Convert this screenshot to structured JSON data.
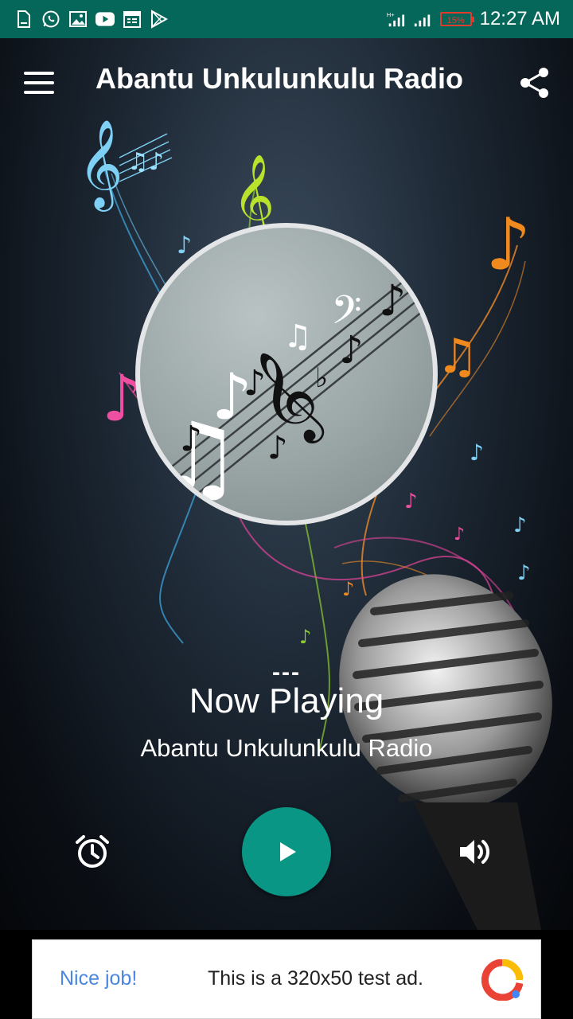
{
  "status_bar": {
    "time": "12:27 AM",
    "battery": "15%",
    "left_icons": [
      "file-icon",
      "whatsapp-icon",
      "image-icon",
      "youtube-icon",
      "calendar-icon",
      "play-store-icon"
    ],
    "right_icons": [
      "signal-ht-icon",
      "signal-icon",
      "battery-icon"
    ]
  },
  "app_bar": {
    "title": "Abantu Unkulunkulu Radio",
    "menu_icon": "hamburger-menu-icon",
    "share_icon": "share-icon"
  },
  "player": {
    "track_placeholder": "---",
    "now_playing_label": "Now Playing",
    "station_name": "Abantu Unkulunkulu Radio",
    "controls": {
      "alarm_icon": "alarm-clock-icon",
      "play_icon": "play-icon",
      "volume_icon": "volume-icon"
    }
  },
  "ad": {
    "badge": "Nice job!",
    "text": "This is a 320x50 test ad."
  },
  "colors": {
    "status_bar": "#05665a",
    "play_button": "#0a9685",
    "ad_accent": "#4a86e0"
  }
}
